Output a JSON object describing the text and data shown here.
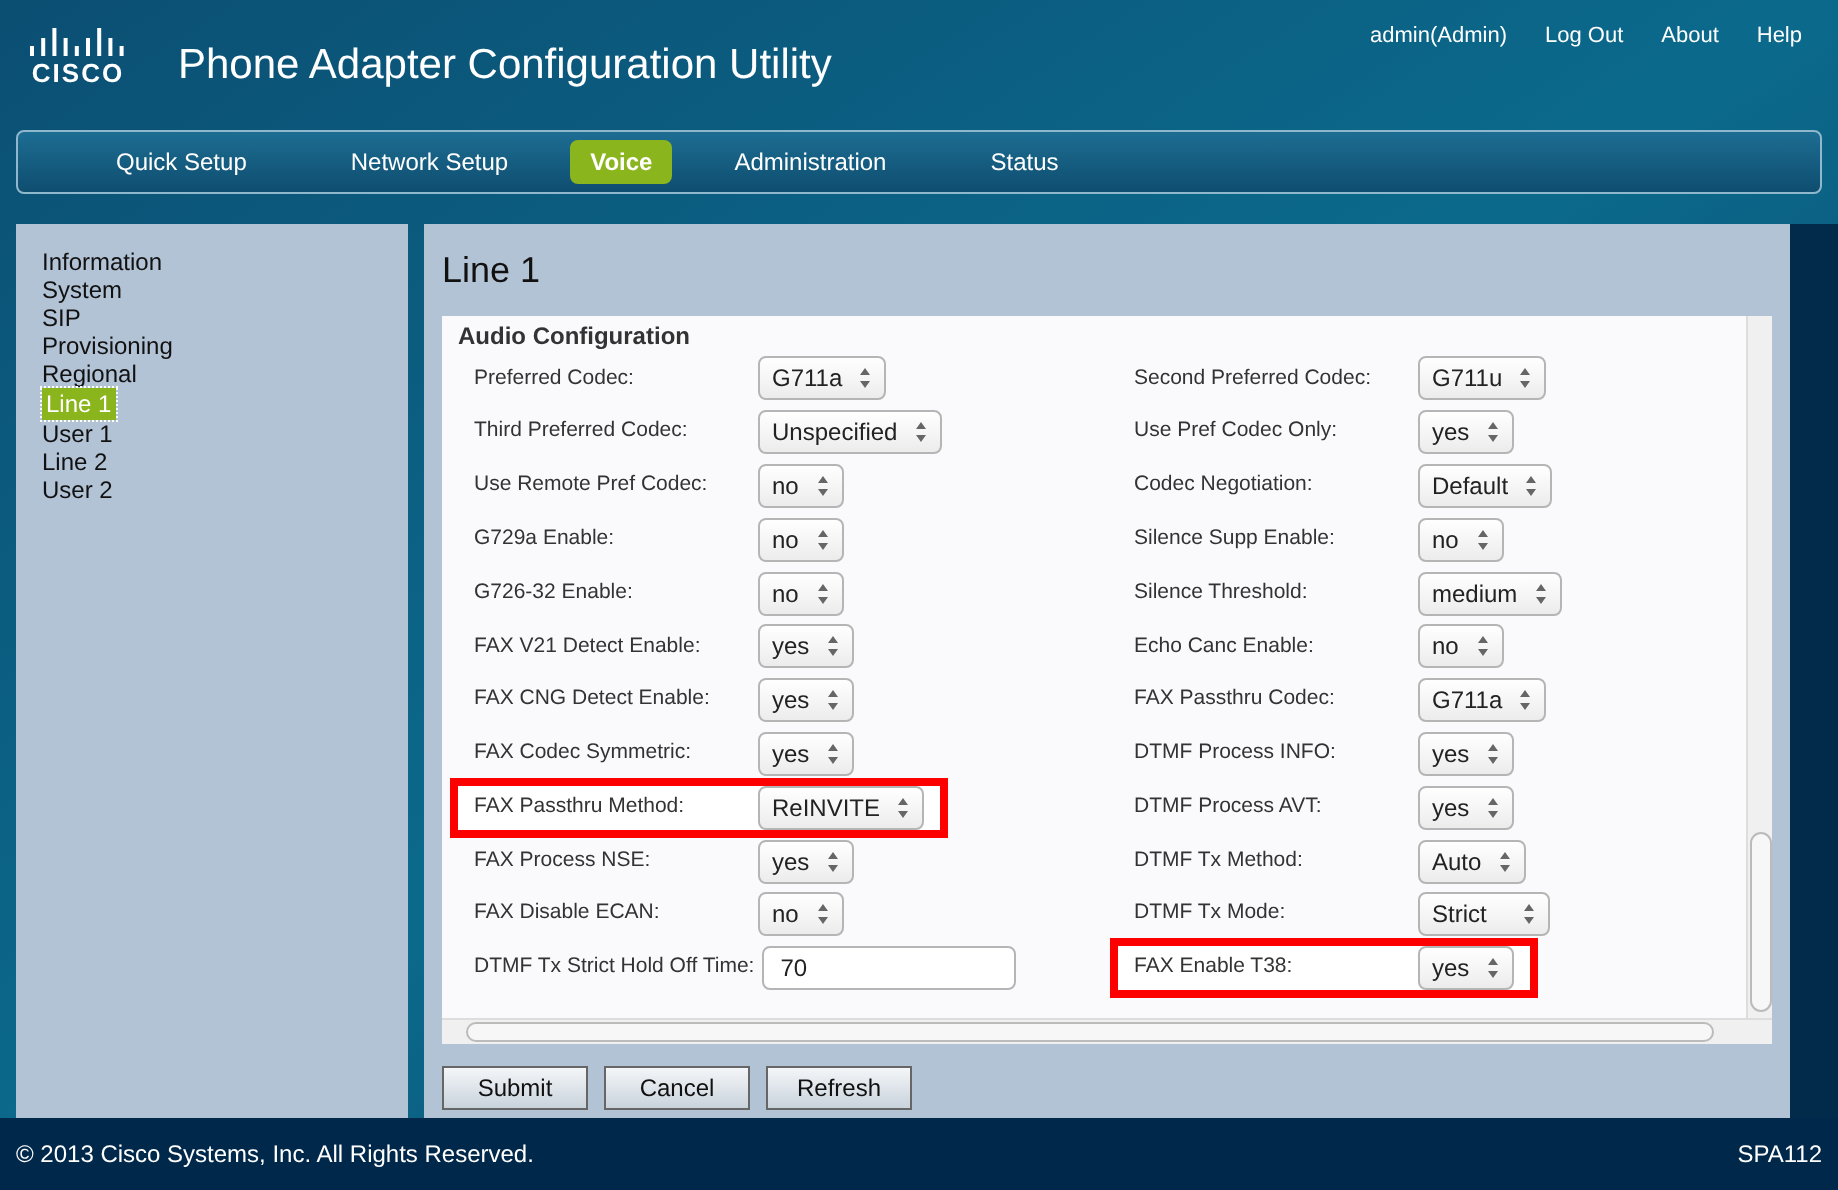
{
  "header": {
    "logo_text": "CISCO",
    "title": "Phone Adapter Configuration Utility",
    "links": [
      "admin(Admin)",
      "Log Out",
      "About",
      "Help"
    ]
  },
  "tabs": [
    {
      "label": "Quick Setup",
      "selected": false
    },
    {
      "label": "Network Setup",
      "selected": false
    },
    {
      "label": "Voice",
      "selected": true
    },
    {
      "label": "Administration",
      "selected": false
    },
    {
      "label": "Status",
      "selected": false
    }
  ],
  "sidebar": {
    "items": [
      {
        "label": "Information",
        "selected": false
      },
      {
        "label": "System",
        "selected": false
      },
      {
        "label": "SIP",
        "selected": false
      },
      {
        "label": "Provisioning",
        "selected": false
      },
      {
        "label": "Regional",
        "selected": false
      },
      {
        "label": "Line 1",
        "selected": true
      },
      {
        "label": "User 1",
        "selected": false
      },
      {
        "label": "Line 2",
        "selected": false
      },
      {
        "label": "User 2",
        "selected": false
      }
    ]
  },
  "page_title": "Line 1",
  "section_title": "Audio Configuration",
  "rows": [
    {
      "left": {
        "label": "Preferred Codec:",
        "value": "G711a",
        "kind": "select",
        "highlighted": false
      },
      "right": {
        "label": "Second Preferred Codec:",
        "value": "G711u",
        "kind": "select",
        "highlighted": false
      }
    },
    {
      "left": {
        "label": "Third Preferred Codec:",
        "value": "Unspecified",
        "kind": "select",
        "highlighted": false
      },
      "right": {
        "label": "Use Pref Codec Only:",
        "value": "yes",
        "kind": "select",
        "highlighted": false
      }
    },
    {
      "left": {
        "label": "Use Remote Pref Codec:",
        "value": "no",
        "kind": "select",
        "highlighted": false
      },
      "right": {
        "label": "Codec Negotiation:",
        "value": "Default",
        "kind": "select",
        "highlighted": false
      }
    },
    {
      "left": {
        "label": "G729a Enable:",
        "value": "no",
        "kind": "select",
        "highlighted": false
      },
      "right": {
        "label": "Silence Supp Enable:",
        "value": "no",
        "kind": "select",
        "highlighted": false
      }
    },
    {
      "left": {
        "label": "G726-32 Enable:",
        "value": "no",
        "kind": "select",
        "highlighted": false
      },
      "right": {
        "label": "Silence Threshold:",
        "value": "medium",
        "kind": "select",
        "highlighted": false
      }
    },
    {
      "left": {
        "label": "FAX V21 Detect Enable:",
        "value": "yes",
        "kind": "select",
        "highlighted": false
      },
      "right": {
        "label": "Echo Canc Enable:",
        "value": "no",
        "kind": "select",
        "highlighted": false
      }
    },
    {
      "left": {
        "label": "FAX CNG Detect Enable:",
        "value": "yes",
        "kind": "select",
        "highlighted": false
      },
      "right": {
        "label": "FAX Passthru Codec:",
        "value": "G711a",
        "kind": "select",
        "highlighted": false
      }
    },
    {
      "left": {
        "label": "FAX Codec Symmetric:",
        "value": "yes",
        "kind": "select",
        "highlighted": false
      },
      "right": {
        "label": "DTMF Process INFO:",
        "value": "yes",
        "kind": "select",
        "highlighted": false
      }
    },
    {
      "left": {
        "label": "FAX Passthru Method:",
        "value": "ReINVITE",
        "kind": "select",
        "highlighted": true
      },
      "right": {
        "label": "DTMF Process AVT:",
        "value": "yes",
        "kind": "select",
        "highlighted": false
      }
    },
    {
      "left": {
        "label": "FAX Process NSE:",
        "value": "yes",
        "kind": "select",
        "highlighted": false
      },
      "right": {
        "label": "DTMF Tx Method:",
        "value": "Auto",
        "kind": "select",
        "highlighted": false
      }
    },
    {
      "left": {
        "label": "FAX Disable ECAN:",
        "value": "no",
        "kind": "select",
        "highlighted": false
      },
      "right": {
        "label": "DTMF Tx Mode:",
        "value": "Strict",
        "kind": "select",
        "highlighted": false
      }
    },
    {
      "left": {
        "label": "DTMF Tx Strict Hold Off Time:",
        "value": "70",
        "kind": "text",
        "highlighted": false
      },
      "right": {
        "label": "FAX Enable T38:",
        "value": "yes",
        "kind": "select",
        "highlighted": true
      }
    }
  ],
  "buttons": [
    "Submit",
    "Cancel",
    "Refresh"
  ],
  "footer": {
    "copyright": "© 2013 Cisco Systems, Inc. All Rights Reserved.",
    "model": "SPA112"
  }
}
